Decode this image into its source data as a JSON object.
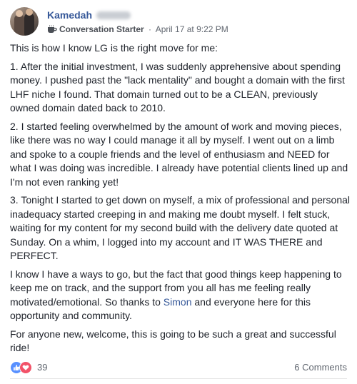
{
  "post": {
    "author": {
      "name": "Kamedah"
    },
    "meta": {
      "badge_label": "Conversation Starter",
      "separator": "·",
      "timestamp": "April 17 at 9:22 PM",
      "badge_icon": "coffee-cup-icon"
    },
    "body": {
      "intro": "This is how I know LG is the right move for me:",
      "p1": "1. After the initial investment, I was suddenly apprehensive about spending money. I pushed past the \"lack mentality\" and bought a domain with the first LHF niche I found. That domain turned out to be a CLEAN, previously owned domain dated back to 2010.",
      "p2": "2. I started feeling overwhelmed by the amount of work and moving pieces, like there was no way I could manage it all by myself. I went out on a limb and spoke to a couple friends and the level of enthusiasm and NEED for what I was doing was incredible. I already have potential clients lined up and I'm not even ranking yet!",
      "p3": "3. Tonight I started to get down on myself, a mix of professional and personal inadequacy started creeping in and making me doubt myself. I felt stuck, waiting for my content for my second build with the delivery date quoted at Sunday. On a whim, I logged into my account and IT WAS THERE and PERFECT.",
      "p4_before": "I know I have a ways to go, but the fact that good things keep happening to keep me on track, and the support from you all has me feeling really motivated/emotional. So thanks to ",
      "p4_link": "Simon",
      "p4_after": " and everyone here for this opportunity and community.",
      "p5": "For anyone new, welcome, this is going to be such a great and successful ride!"
    },
    "footer": {
      "reaction_count": "39",
      "comments_label": "6 Comments",
      "reaction_icons": [
        "like-icon",
        "love-icon"
      ]
    },
    "colors": {
      "link": "#365899",
      "like": "#5890ff",
      "love": "#f25268",
      "meta": "#616770"
    }
  }
}
